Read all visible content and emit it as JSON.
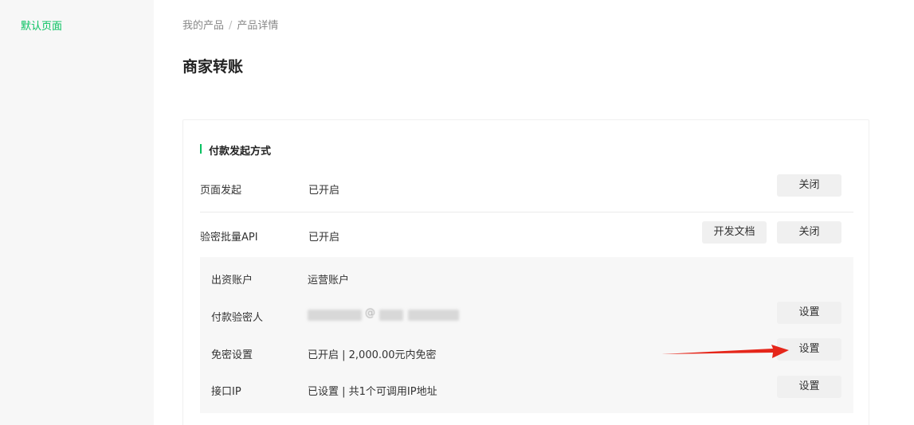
{
  "sidebar": {
    "items": [
      {
        "label": "默认页面"
      }
    ]
  },
  "breadcrumb": {
    "items": [
      "我的产品",
      "产品详情"
    ],
    "separator": "/"
  },
  "page": {
    "title": "商家转账"
  },
  "section": {
    "title": "付款发起方式",
    "rows": [
      {
        "label": "页面发起",
        "value": "已开启",
        "button": "关闭"
      },
      {
        "label": "验密批量API",
        "value": "已开启",
        "doc_button": "开发文档",
        "button": "关闭"
      }
    ],
    "api_settings": [
      {
        "label": "出资账户",
        "value": "运营账户"
      },
      {
        "label": "付款验密人",
        "value": "@",
        "button": "设置"
      },
      {
        "label": "免密设置",
        "value": "已开启 | 2,000.00元内免密",
        "button": "设置"
      },
      {
        "label": "接口IP",
        "value": "已设置 | 共1个可调用IP地址",
        "button": "设置"
      }
    ]
  },
  "colors": {
    "accent": "#07c160",
    "annotation_arrow": "#e5261a"
  }
}
